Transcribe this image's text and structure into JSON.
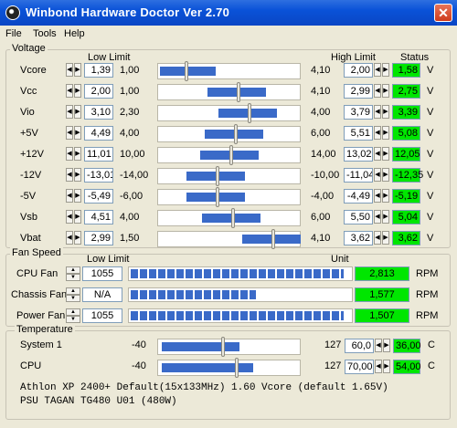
{
  "window": {
    "title": "Winbond Hardware Doctor Ver 2.70",
    "close_glyph": "✕",
    "icon": "app-icon"
  },
  "menu": [
    "File",
    "Tools",
    "Help"
  ],
  "voltage": {
    "group_title": "Voltage",
    "low_limit_header": "Low Limit",
    "high_limit_header": "High Limit",
    "status_header": "Status",
    "rows": [
      {
        "name": "Vcore",
        "low": "1,39",
        "min": "1,00",
        "max": "4,10",
        "high": "2,00",
        "status": "1,58",
        "unit": "V",
        "level": 0.19
      },
      {
        "name": "Vcc",
        "low": "2,00",
        "min": "1,00",
        "max": "4,10",
        "high": "2,99",
        "status": "2,75",
        "unit": "V",
        "level": 0.56
      },
      {
        "name": "Vio",
        "low": "3,10",
        "min": "2,30",
        "max": "4,00",
        "high": "3,79",
        "status": "3,39",
        "unit": "V",
        "level": 0.64
      },
      {
        "name": "+5V",
        "low": "4,49",
        "min": "4,00",
        "max": "6,00",
        "high": "5,51",
        "status": "5,08",
        "unit": "V",
        "level": 0.54
      },
      {
        "name": "+12V",
        "low": "11,01",
        "min": "10,00",
        "max": "14,00",
        "high": "13,02",
        "status": "12,05",
        "unit": "V",
        "level": 0.51
      },
      {
        "name": "-12V",
        "low": "-13,01",
        "min": "-14,00",
        "max": "-10,00",
        "high": "-11,04",
        "status": "-12,35",
        "unit": "V",
        "level": 0.41
      },
      {
        "name": "-5V",
        "low": "-5,49",
        "min": "-6,00",
        "max": "-4,00",
        "high": "-4,49",
        "status": "-5,19",
        "unit": "V",
        "level": 0.41
      },
      {
        "name": "Vsb",
        "low": "4,51",
        "min": "4,00",
        "max": "6,00",
        "high": "5,50",
        "status": "5,04",
        "unit": "V",
        "level": 0.52
      },
      {
        "name": "Vbat",
        "low": "2,99",
        "min": "1,50",
        "max": "4,10",
        "high": "3,62",
        "status": "3,62",
        "unit": "V",
        "level": 0.81
      }
    ]
  },
  "fan": {
    "group_title": "Fan Speed",
    "low_limit_header": "Low Limit",
    "unit_header": "Unit",
    "rows": [
      {
        "name": "CPU Fan",
        "low": "1055",
        "value": "2,813",
        "unit": "RPM",
        "level": 0.97
      },
      {
        "name": "Chassis Fan",
        "low": "N/A",
        "value": "1,577",
        "unit": "RPM",
        "level": 0.57
      },
      {
        "name": "Power Fan",
        "low": "1055",
        "value": "1,507",
        "unit": "RPM",
        "level": 0.97
      }
    ]
  },
  "temperature": {
    "group_title": "Temperature",
    "rows": [
      {
        "name": "System 1",
        "min": "-40",
        "max": "127",
        "high": "60,0",
        "status": "36,00",
        "unit": "C",
        "level": 0.45
      },
      {
        "name": "CPU",
        "min": "-40",
        "max": "127",
        "high": "70,00",
        "status": "54,00",
        "unit": "C",
        "level": 0.55
      }
    ]
  },
  "notes": [
    "Athlon XP 2400+ Default(15x133MHz) 1.60 Vcore (default 1.65V)",
    "PSU TAGAN TG480 U01 (480W)"
  ]
}
